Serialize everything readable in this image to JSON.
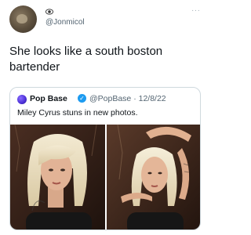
{
  "tweet": {
    "handle": "@Jonmicol",
    "text": "She looks like a south boston bartender",
    "more_label": "···"
  },
  "quoted_tweet": {
    "name": "Pop Base",
    "verified_mark": "✓",
    "handle_date": "@PopBase · 12/8/22",
    "text": "Miley Cyrus stuns in new photos.",
    "photos": [
      {
        "subject": "woman-platinum-hair-portrait"
      },
      {
        "subject": "woman-platinum-hair-posing-arms-raised"
      }
    ]
  },
  "colors": {
    "text": "#0f1419",
    "secondary": "#536471",
    "border": "#cfd9de",
    "verified": "#1d9bf0"
  }
}
